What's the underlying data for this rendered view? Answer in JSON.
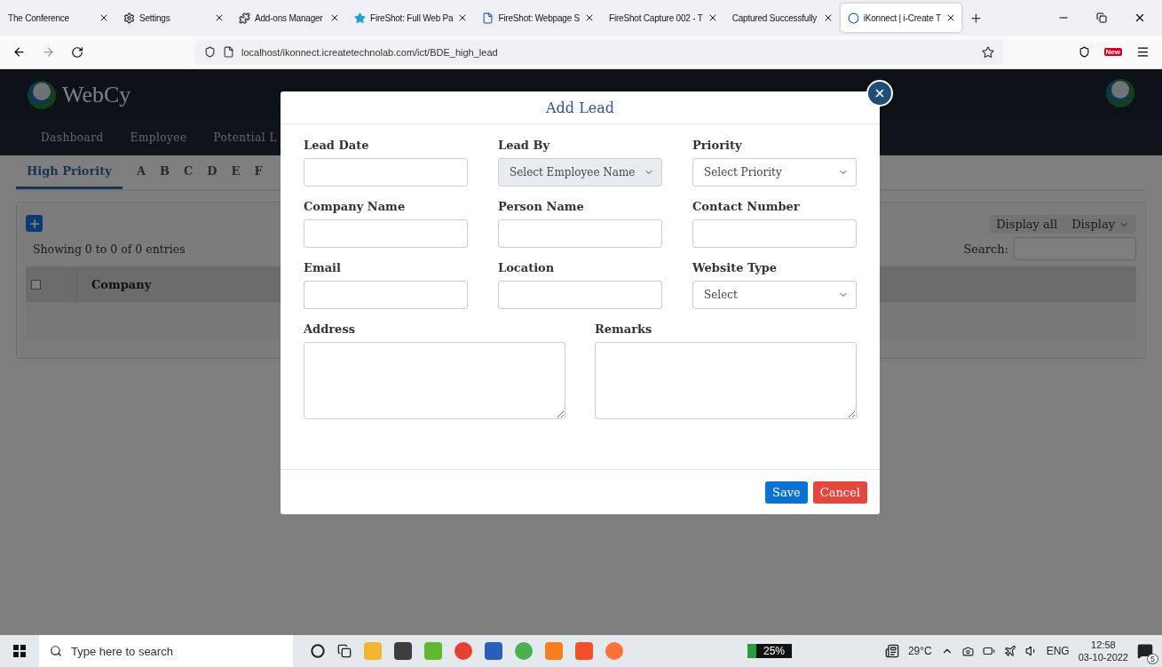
{
  "browser": {
    "tabs": [
      {
        "label": "The Conference",
        "selected": false,
        "kind": "plain"
      },
      {
        "label": "Settings",
        "selected": false,
        "kind": "gear"
      },
      {
        "label": "Add-ons Manager",
        "selected": false,
        "kind": "puzzle"
      },
      {
        "label": "FireShot: Full Web Pa",
        "selected": false,
        "kind": "star"
      },
      {
        "label": "FireShot: Webpage S",
        "selected": false,
        "kind": "doc"
      },
      {
        "label": "FireShot Capture 002 - T",
        "selected": false,
        "kind": "plain"
      },
      {
        "label": "Captured Successfully",
        "selected": false,
        "kind": "plain"
      },
      {
        "label": "iKonnect | i-Create T",
        "selected": true,
        "kind": "globe"
      }
    ],
    "url": "localhost/ikonnect.icreatetechnolab.com/ict/BDE_high_lead",
    "new_badge": "New"
  },
  "app": {
    "brand": "WebCy",
    "nav": [
      "Dashboard",
      "Employee",
      "Potential L"
    ],
    "subtabs": [
      {
        "label": "High Priority",
        "selected": true
      },
      {
        "label": "A",
        "selected": false
      },
      {
        "label": "B",
        "selected": false
      },
      {
        "label": "C",
        "selected": false
      },
      {
        "label": "D",
        "selected": false
      },
      {
        "label": "E",
        "selected": false
      },
      {
        "label": "F",
        "selected": false
      }
    ],
    "info": "Showing 0 to 0 of 0 entries",
    "display_all": "Display all",
    "display": "Display",
    "search_label": "Search:",
    "table": {
      "columns": [
        "Company"
      ],
      "select_all_checked": false
    }
  },
  "modal": {
    "title": "Add Lead",
    "rows": [
      [
        {
          "label": "Lead Date",
          "kind": "input",
          "disabled": false
        },
        {
          "label": "Lead By",
          "kind": "select",
          "value": "Select Employee Name",
          "disabled": true
        },
        {
          "label": "Priority",
          "kind": "select",
          "value": "Select Priority",
          "disabled": false
        }
      ],
      [
        {
          "label": "Company Name",
          "kind": "input",
          "disabled": false
        },
        {
          "label": "Person Name",
          "kind": "input",
          "disabled": false
        },
        {
          "label": "Contact Number",
          "kind": "input",
          "disabled": false
        }
      ],
      [
        {
          "label": "Email",
          "kind": "input",
          "disabled": false
        },
        {
          "label": "Location",
          "kind": "input",
          "disabled": false
        },
        {
          "label": "Website Type",
          "kind": "select",
          "value": "Select",
          "disabled": false
        }
      ],
      [
        {
          "label": "Address",
          "kind": "textarea",
          "disabled": false
        },
        {
          "label": "Remarks",
          "kind": "textarea",
          "disabled": false
        }
      ]
    ],
    "buttons": [
      {
        "label": "Save",
        "kind": "primary"
      },
      {
        "label": "Cancel",
        "kind": "danger"
      }
    ]
  },
  "taskbar": {
    "search_placeholder": "Type here to search",
    "battery": "25%",
    "temperature": "29°C",
    "language": "ENG",
    "time": "12:58",
    "date": "03-10-2022",
    "notifications": "5"
  }
}
